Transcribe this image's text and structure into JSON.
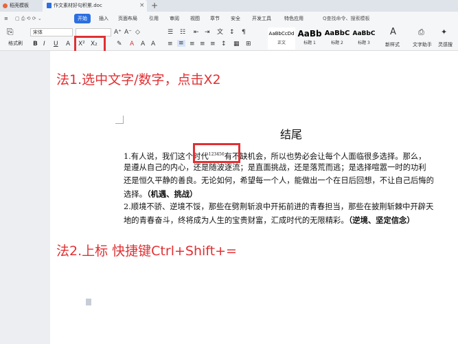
{
  "tabs": {
    "home": "稻壳模板",
    "doc": "作文素材好句积累.doc",
    "close": "×",
    "new": "+"
  },
  "menu": {
    "items": [
      "文件",
      "开始",
      "插入",
      "页面布局",
      "引用",
      "审阅",
      "视图",
      "章节",
      "安全",
      "开发工具",
      "特色应用"
    ],
    "active": "开始",
    "search": "Q查找命令、搜索模板"
  },
  "ribbon": {
    "paste": "粘贴",
    "format_painter": "格式刷",
    "font_name": "宋体",
    "font_size": "",
    "grow": "A⁺",
    "shrink": "A⁻",
    "bold": "B",
    "italic": "I",
    "underline": "U",
    "superscript": "X²",
    "subscript": "X₂",
    "styles": [
      {
        "sample": "AaBbCcDd",
        "label": "正文"
      },
      {
        "sample": "AaBb",
        "label": "标题 1"
      },
      {
        "sample": "AaBbC",
        "label": "标题 2"
      },
      {
        "sample": "AaBbC",
        "label": "标题 3"
      }
    ],
    "new_style": "新样式",
    "text_tools": "文字助手",
    "inspiration": "灵感搜"
  },
  "annotations": {
    "method1": "法1.选中文字/数字，点击X2",
    "method2": "法2.上标 快捷键Ctrl+Shift+="
  },
  "document": {
    "title": "结尾",
    "line1_a": "1.有人说，我们这个时代",
    "line1_sup": "123456",
    "line1_b": "有不缺机会，所以也势必会让每个人面临很多选择。那么，",
    "line2": "是遵从自己的内心，还是随波逐流；是直面挑战，还是落荒而逃；是选择喧嚣一时的功利",
    "line3": "还是恒久平静的善良。无论如何，希望每一个人，能做出一个在日后回想，不让自己后悔的",
    "line4_a": "选择。",
    "line4_b": "（机遇、挑战）",
    "line5": "2.顺境不骄、逆境不馁，那些在劈荆斩浪中开拓前进的青春担当，那些在披荆斩棘中开辟天",
    "line6_a": "地的青春奋斗，终将成为人生的宝贵财富，汇成时代的无限精彩。",
    "line6_b": "（逆境、坚定信念）"
  },
  "colors": {
    "accent": "#2b6fe0",
    "annotation_red": "#e03033"
  }
}
